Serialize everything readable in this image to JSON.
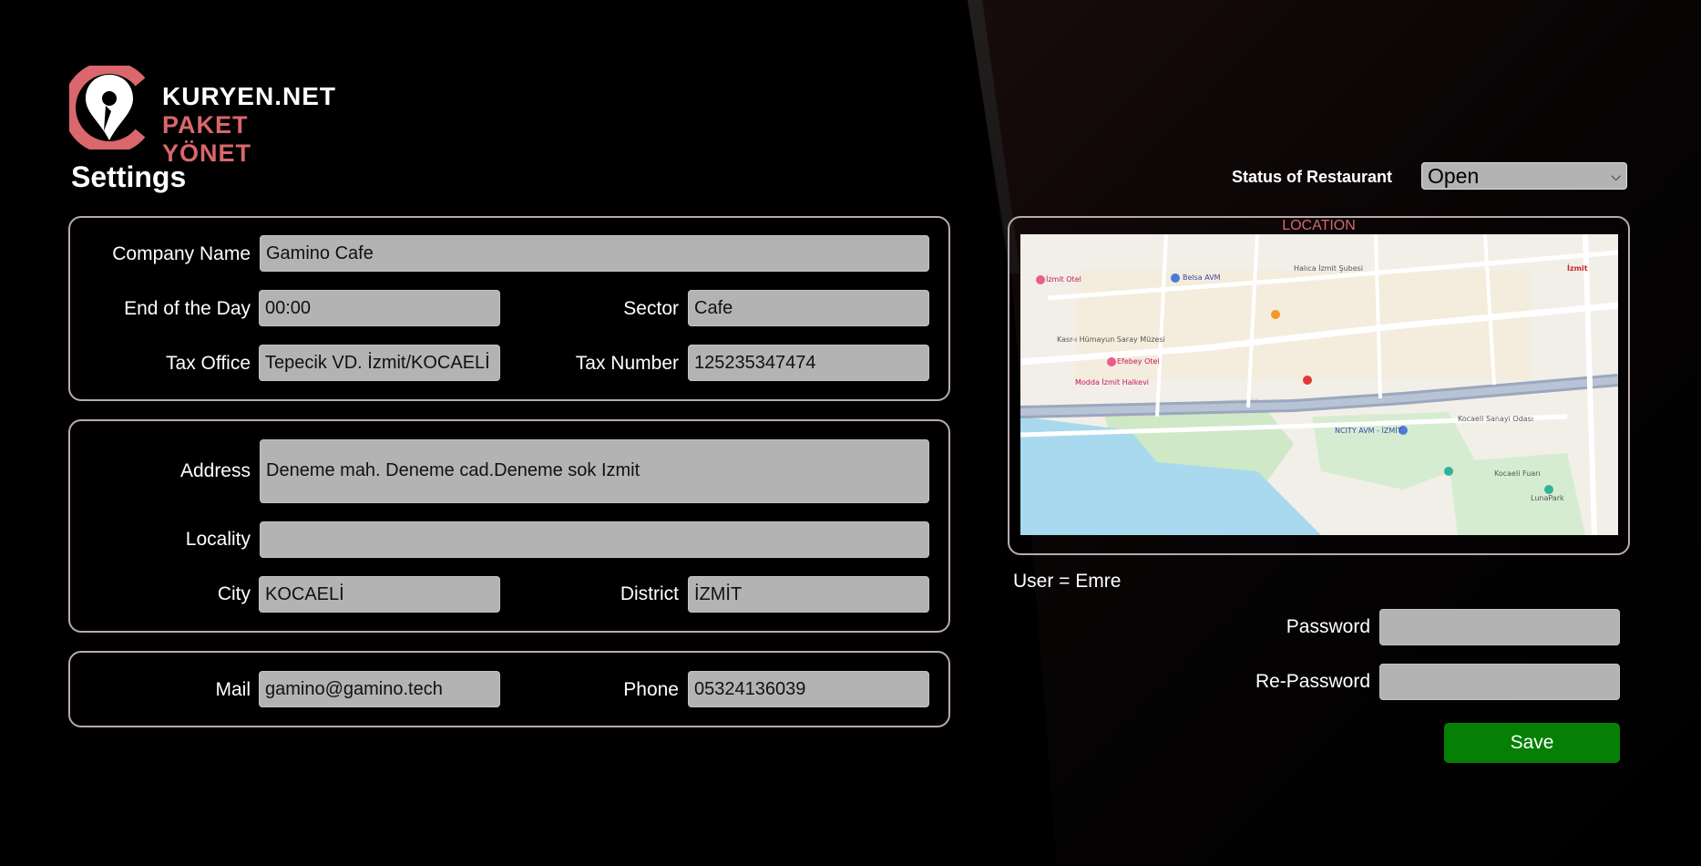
{
  "brand": {
    "line1": "KURYEN.NET",
    "line2": "PAKET YÖNET",
    "accent": "#d9676b"
  },
  "page_title": "Settings",
  "company": {
    "company_name_label": "Company Name",
    "company_name": "Gamino Cafe",
    "end_of_day_label": "End of the Day",
    "end_of_day": "00:00",
    "sector_label": "Sector",
    "sector": "Cafe",
    "tax_office_label": "Tax Office",
    "tax_office": "Tepecik VD. İzmit/KOCAELİ",
    "tax_number_label": "Tax Number",
    "tax_number": "125235347474"
  },
  "address": {
    "address_label": "Address",
    "address": "Deneme mah. Deneme cad.Deneme sok Izmit",
    "locality_label": "Locality",
    "locality": "",
    "city_label": "City",
    "city": "KOCAELİ",
    "district_label": "District",
    "district": "İZMİT"
  },
  "contact": {
    "mail_label": "Mail",
    "mail": "gamino@gamino.tech",
    "phone_label": "Phone",
    "phone": "05324136039"
  },
  "status": {
    "label": "Status of Restaurant",
    "selected": "Open"
  },
  "location": {
    "caption": "LOCATION",
    "map_labels": {
      "izmit_otel": "İzmit Otel",
      "belsa_avm": "Belsa AVM",
      "halica_sube": "Halıca İzmit Şubesi",
      "kasri_humayun": "Kasr-ı Hümayun Saray Müzesi",
      "efebey_otel": "Efebey Otel",
      "modda_halkevi": "Modda İzmit Halkevi",
      "ncity_avm": "NCITY AVM - İZMİT",
      "kocaeli_sanayi": "Kocaeli Sanayi Odası",
      "kocaeli_fuari": "Kocaeli Fuarı",
      "lunapark": "LunaPark",
      "izmit": "İzmit"
    }
  },
  "account": {
    "user_text": "User = Emre",
    "password_label": "Password",
    "repassword_label": "Re-Password",
    "save_label": "Save"
  }
}
